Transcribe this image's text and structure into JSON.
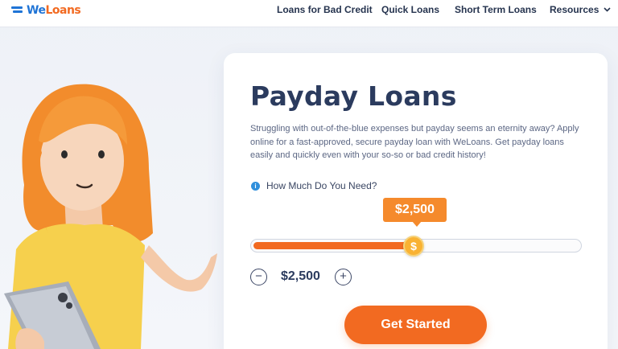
{
  "brand": {
    "we": "We",
    "loans": "Loans"
  },
  "nav": {
    "items": [
      {
        "label": "Loans for Bad Credit"
      },
      {
        "label": "Quick Loans"
      },
      {
        "label": "Short Term Loans"
      },
      {
        "label": "Resources"
      }
    ]
  },
  "hero": {
    "title": "Payday Loans",
    "description": "Struggling with out-of-the-blue expenses but payday seems an eternity away? Apply online for a fast-approved, secure payday loan with WeLoans. Get payday loans easily and quickly even with your so-so or bad credit history!",
    "amount_question": "How Much Do You Need?",
    "amount_tooltip": "$2,500",
    "amount_value": "$2,500",
    "slider_fraction": 0.5,
    "thumb_symbol": "$",
    "minus_symbol": "−",
    "plus_symbol": "+",
    "info_symbol": "i",
    "cta_label": "Get Started"
  },
  "icons": {
    "logo": "weloans-logo-icon",
    "dropdown": "chevron-down-icon",
    "info": "info-icon",
    "minus": "minus-circle-icon",
    "plus": "plus-circle-icon",
    "thumb": "dollar-coin-icon"
  },
  "colors": {
    "accent_orange": "#f26a21",
    "brand_blue": "#1f74d6",
    "title_navy": "#2b3b5e"
  }
}
